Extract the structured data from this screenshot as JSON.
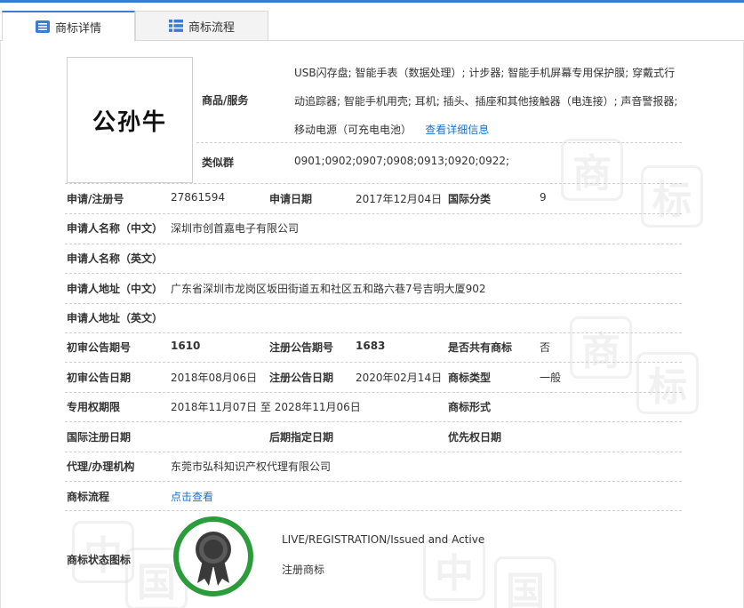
{
  "tabs": [
    {
      "label": "商标详情",
      "active": true
    },
    {
      "label": "商标流程",
      "active": false
    }
  ],
  "logo": {
    "text": "公孙牛"
  },
  "goods": {
    "label": "商品/服务",
    "text": "USB闪存盘; 智能手表（数据处理）; 计步器; 智能手机屏幕专用保护膜; 穿戴式行动追踪器; 智能手机用壳; 耳机; 插头、插座和其他接触器（电连接）; 声音警报器; 移动电源（可充电电池）",
    "more_link": "查看详细信息"
  },
  "similar_group": {
    "label": "类似群",
    "value": "0901;0902;0907;0908;0913;0920;0922;"
  },
  "fields": {
    "app_no": {
      "label": "申请/注册号",
      "value": "27861594"
    },
    "app_date": {
      "label": "申请日期",
      "value": "2017年12月04日"
    },
    "intl_class": {
      "label": "国际分类",
      "value": "9"
    },
    "applicant_cn": {
      "label": "申请人名称（中文）",
      "value": "深圳市创首嘉电子有限公司"
    },
    "applicant_en": {
      "label": "申请人名称（英文）",
      "value": ""
    },
    "address_cn": {
      "label": "申请人地址（中文）",
      "value": "广东省深圳市龙岗区坂田街道五和社区五和路六巷7号吉明大厦902"
    },
    "address_en": {
      "label": "申请人地址（英文）",
      "value": ""
    },
    "prelim_issue": {
      "label": "初审公告期号",
      "value": "1610"
    },
    "reg_issue": {
      "label": "注册公告期号",
      "value": "1683"
    },
    "shared": {
      "label": "是否共有商标",
      "value": "否"
    },
    "prelim_date": {
      "label": "初审公告日期",
      "value": "2018年08月06日"
    },
    "reg_date": {
      "label": "注册公告日期",
      "value": "2020年02月14日"
    },
    "tm_type": {
      "label": "商标类型",
      "value": "一般"
    },
    "exclusive": {
      "label": "专用权期限",
      "value": "2018年11月07日 至 2028年11月06日"
    },
    "tm_form": {
      "label": "商标形式",
      "value": ""
    },
    "intl_reg_date": {
      "label": "国际注册日期",
      "value": ""
    },
    "later_date": {
      "label": "后期指定日期",
      "value": ""
    },
    "priority_date": {
      "label": "优先权日期",
      "value": ""
    },
    "agent": {
      "label": "代理/办理机构",
      "value": "东莞市弘科知识产权代理有限公司"
    },
    "process": {
      "label": "商标流程",
      "value": "点击查看"
    },
    "status": {
      "label": "商标状态图标",
      "status_en": "LIVE/REGISTRATION/Issued and Active",
      "status_cn": "注册商标"
    }
  },
  "watermark_chars": [
    "中",
    "国",
    "商",
    "标"
  ],
  "colors": {
    "accent": "#3a7bd5",
    "link": "#1a73c8",
    "status_ring": "#2a9d3a",
    "ribbon": "#3a3a3a"
  }
}
